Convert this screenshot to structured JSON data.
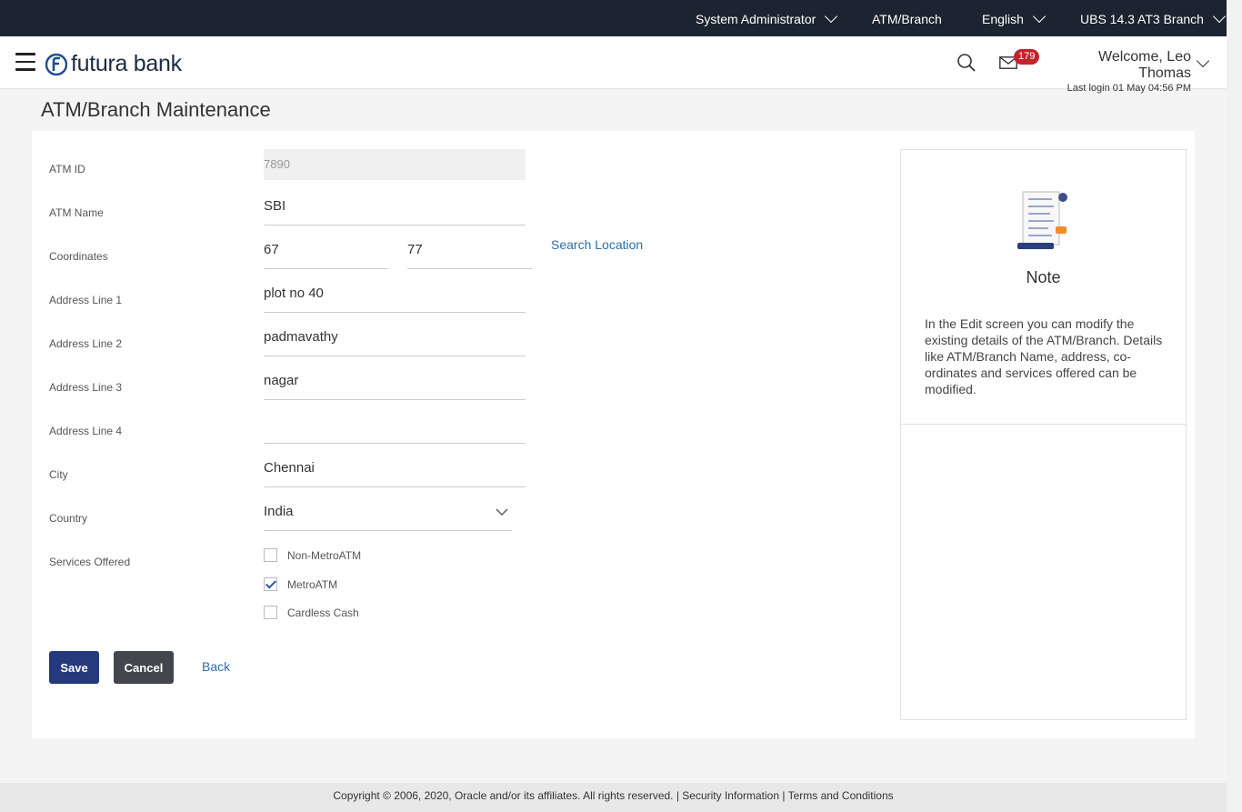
{
  "topbar": {
    "role": "System Administrator",
    "module": "ATM/Branch",
    "language": "English",
    "branch": "UBS 14.3 AT3 Branch"
  },
  "header": {
    "brand": "futura bank",
    "notification_count": "179",
    "welcome": "Welcome, Leo Thomas",
    "last_login": "Last login 01 May 04:56 PM"
  },
  "page": {
    "title": "ATM/Branch Maintenance"
  },
  "form": {
    "atm_id_label": "ATM ID",
    "atm_id_value": "7890",
    "atm_name_label": "ATM Name",
    "atm_name_value": "SBI",
    "coordinates_label": "Coordinates",
    "latitude_value": "67",
    "longitude_value": "77",
    "search_location": "Search Location",
    "address1_label": "Address Line 1",
    "address1_value": "plot no 40",
    "address2_label": "Address Line 2",
    "address2_value": "padmavathy",
    "address3_label": "Address Line 3",
    "address3_value": "nagar",
    "address4_label": "Address Line 4",
    "address4_value": "",
    "city_label": "City",
    "city_value": "Chennai",
    "country_label": "Country",
    "country_value": "India",
    "services_label": "Services Offered",
    "services": [
      {
        "label": "Non-MetroATM",
        "checked": false
      },
      {
        "label": "MetroATM",
        "checked": true
      },
      {
        "label": "Cardless Cash",
        "checked": false
      }
    ]
  },
  "actions": {
    "save": "Save",
    "cancel": "Cancel",
    "back": "Back"
  },
  "note": {
    "title": "Note",
    "text": "In the Edit screen you can modify the existing details of the ATM/Branch. Details like ATM/Branch Name, address, co-ordinates and services offered can be modified."
  },
  "footer": {
    "copyright": "Copyright © 2006, 2020, Oracle and/or its affiliates. All rights reserved. | Security Information | Terms and Conditions"
  },
  "colors": {
    "topbar": "#1c2331",
    "primary_button": "#243a7d",
    "secondary_button": "#43464d",
    "link": "#2f6ea5",
    "badge": "#c4232b"
  }
}
